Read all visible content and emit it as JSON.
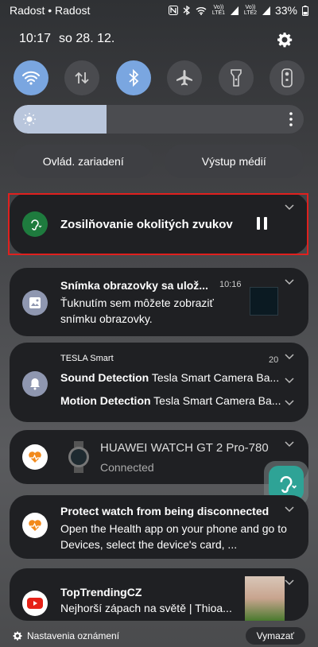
{
  "status_bar": {
    "carriers": "Radost • Radost",
    "battery": "33%",
    "lte1": "Vo)) LTE1",
    "lte2": "Vo)) LTE2"
  },
  "header": {
    "time": "10:17",
    "date": "so 28. 12."
  },
  "quick_settings": [
    {
      "id": "wifi",
      "icon": "wifi-icon",
      "on": true
    },
    {
      "id": "mobile-data",
      "icon": "data-arrows-icon",
      "on": false
    },
    {
      "id": "bluetooth",
      "icon": "bluetooth-icon",
      "on": true
    },
    {
      "id": "airplane",
      "icon": "airplane-icon",
      "on": false
    },
    {
      "id": "flashlight",
      "icon": "flashlight-icon",
      "on": false
    },
    {
      "id": "remote",
      "icon": "remote-icon",
      "on": false
    }
  ],
  "brightness": {
    "level": 0.32
  },
  "pills": {
    "device_control": "Ovlád. zariadení",
    "media_output": "Výstup médií"
  },
  "notifications": {
    "ambient": {
      "title": "Zosilňovanie okolitých zvukov"
    },
    "screenshot": {
      "title": "Snímka obrazovky sa ulož...",
      "time": "10:16",
      "body": "Ťuknutím sem môžete zobraziť snímku obrazovky."
    },
    "tesla": {
      "app": "TESLA Smart",
      "count": "20",
      "line1_bold": "Sound Detection",
      "line1_text": " Tesla Smart Camera Ba...",
      "line2_bold": "Motion Detection",
      "line2_text": " Tesla Smart Camera Ba..."
    },
    "huawei": {
      "title": "HUAWEI WATCH GT 2 Pro-780",
      "sub": "Connected"
    },
    "protect": {
      "title": "Protect watch from being disconnected",
      "body": "Open the Health app on your phone and go to Devices, select the device's card, ..."
    },
    "youtube": {
      "title": "TopTrendingCZ",
      "body": "Nejhorší zápach na světě | Thioa..."
    }
  },
  "footer": {
    "settings": "Nastavenia oznámení",
    "clear": "Vymazať"
  },
  "colors": {
    "accent_on": "#7aa6e0",
    "highlight": "#e0201e",
    "ambient_app": "#1e7b3e",
    "ear_app": "#2ea396"
  }
}
